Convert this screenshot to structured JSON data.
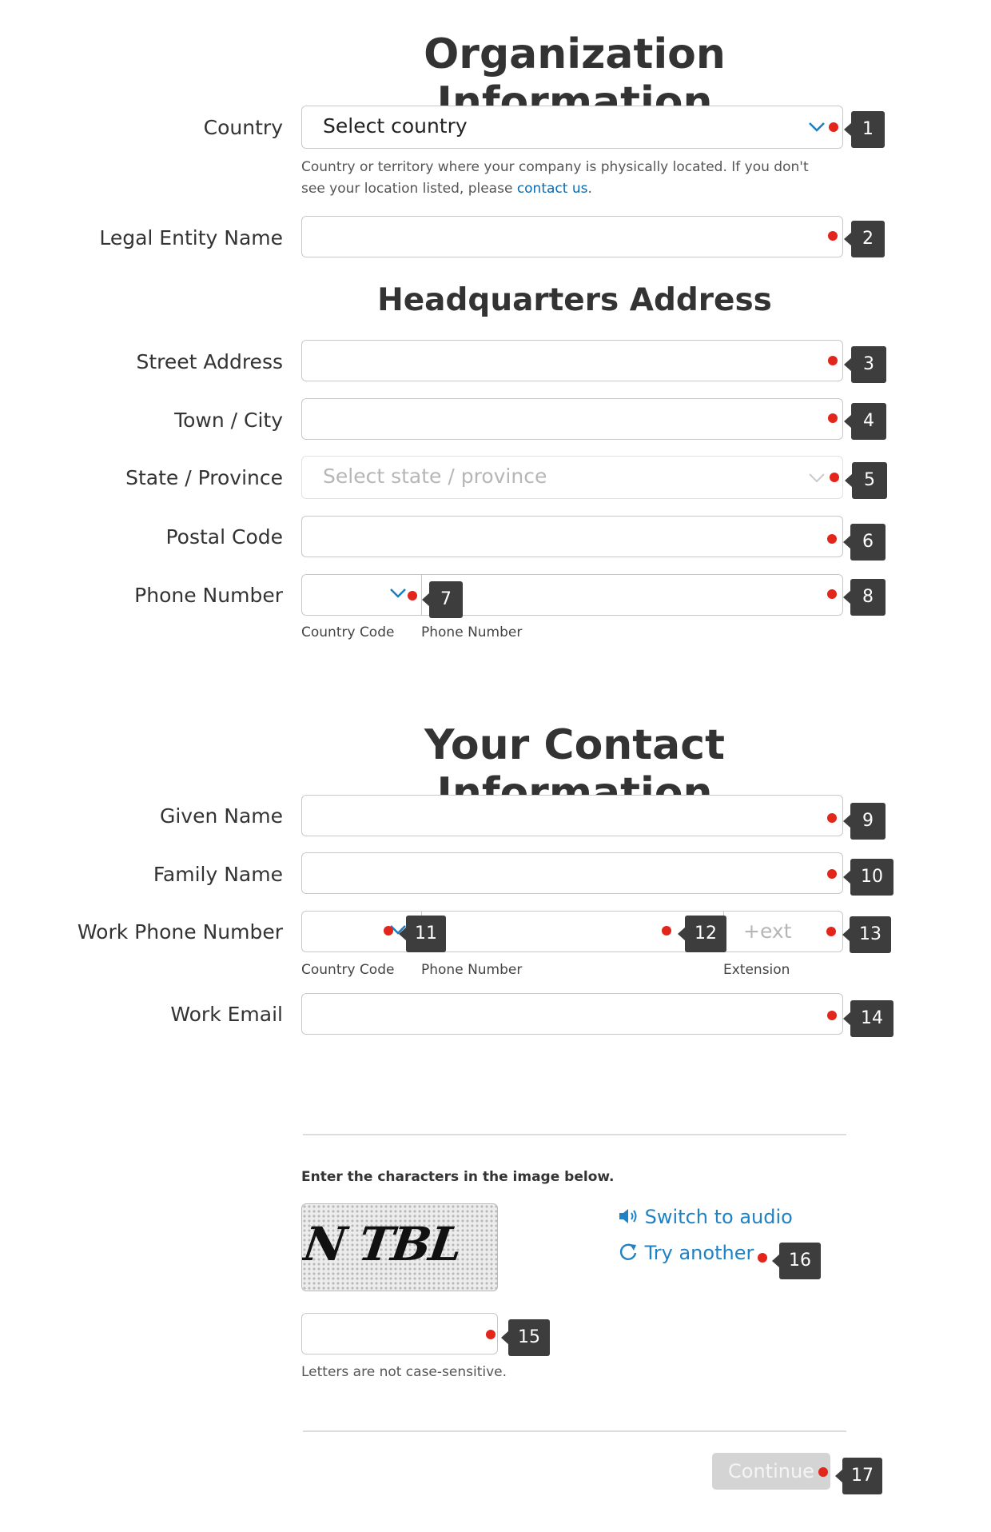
{
  "org_section": {
    "title": "Organization Information",
    "country_label": "Country",
    "country_select_value": "Select country",
    "country_hint_prefix": "Country or territory where your company is physically located. If you don't see your location listed, please ",
    "country_hint_link": "contact us",
    "country_hint_suffix": ".",
    "legal_entity_label": "Legal Entity Name"
  },
  "hq_section": {
    "title": "Headquarters Address",
    "street_label": "Street Address",
    "city_label": "Town / City",
    "state_label": "State / Province",
    "state_placeholder": "Select state / province",
    "postal_label": "Postal Code",
    "phone_label": "Phone Number",
    "country_code_sub": "Country Code",
    "phone_number_sub": "Phone Number"
  },
  "contact_section": {
    "title": "Your Contact Information",
    "given_label": "Given Name",
    "family_label": "Family Name",
    "work_phone_label": "Work Phone Number",
    "ext_placeholder": "+ext",
    "country_code_sub": "Country Code",
    "phone_number_sub": "Phone Number",
    "extension_sub": "Extension",
    "work_email_label": "Work Email"
  },
  "captcha": {
    "instruction": "Enter the characters in the image below.",
    "image_text": "N TBL",
    "switch_audio": "Switch to audio",
    "try_another": "Try another",
    "case_note": "Letters are not case-sensitive."
  },
  "continue_label": "Continue",
  "badges": [
    "1",
    "2",
    "3",
    "4",
    "5",
    "6",
    "7",
    "8",
    "9",
    "10",
    "11",
    "12",
    "13",
    "14",
    "15",
    "16",
    "17"
  ],
  "colors": {
    "marker_dot": "#e2261c",
    "badge_bg": "#3d3d3d",
    "link": "#0a6ab0",
    "chevron": "#1a7fc1"
  }
}
